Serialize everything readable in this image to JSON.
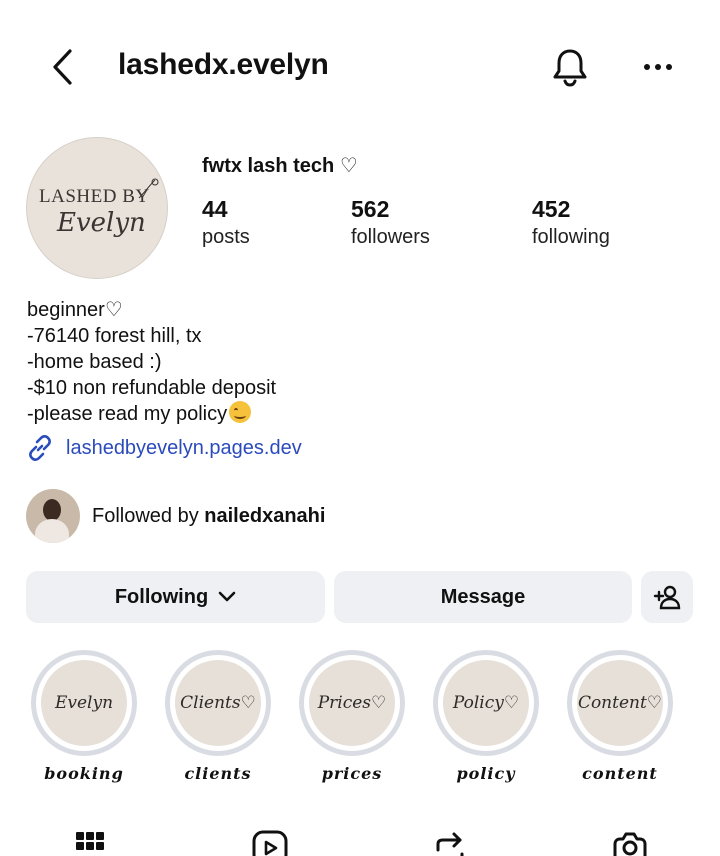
{
  "header": {
    "username": "lashedx.evelyn"
  },
  "profile": {
    "avatar_text_top": "LASHED BY",
    "avatar_text_script": "Evelyn",
    "display_name": "fwtx lash tech ♡",
    "stats": [
      {
        "value": "44",
        "label": "posts"
      },
      {
        "value": "562",
        "label": "followers"
      },
      {
        "value": "452",
        "label": "following"
      }
    ],
    "bio_lines": [
      "beginner♡",
      "-76140 forest hill, tx",
      "-home based :)",
      "-$10 non refundable deposit",
      "-please read my policy"
    ],
    "link": "lashedbyevelyn.pages.dev",
    "followed_by_prefix": "Followed by ",
    "followed_by_user": "nailedxanahi"
  },
  "actions": {
    "following_label": "Following",
    "message_label": "Message"
  },
  "highlights": [
    {
      "cover": "Evelyn",
      "label": "booking"
    },
    {
      "cover": "Clients♡",
      "label": "clients"
    },
    {
      "cover": "Prices♡",
      "label": "prices"
    },
    {
      "cover": "Policy♡",
      "label": "policy"
    },
    {
      "cover": "Content♡",
      "label": "content"
    }
  ],
  "icons": {
    "back": "chevron-left-icon",
    "notifications": "bell-icon",
    "more": "more-horizontal-icon",
    "link": "link-icon",
    "dropdown": "chevron-down-icon",
    "add_user": "add-user-icon",
    "tabs": [
      "grid-icon",
      "reels-icon",
      "reposts-icon",
      "tagged-icon"
    ]
  },
  "colors": {
    "link": "#2b4bbd",
    "button_bg": "#eef0f3",
    "highlight_ring": "#d9dde3"
  }
}
